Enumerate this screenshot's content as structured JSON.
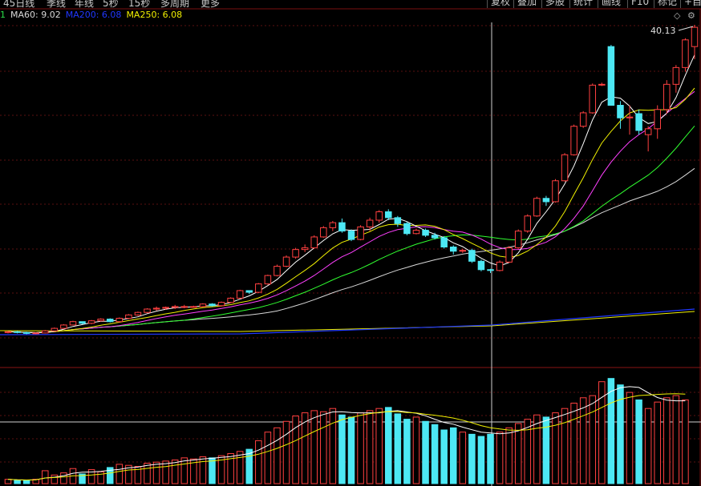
{
  "toolbar": {
    "periods": [
      "45日线",
      "季线",
      "年线",
      "5秒",
      "15秒",
      "多周期",
      "更多"
    ],
    "buttons": [
      "复权",
      "叠加",
      "多股",
      "统计",
      "画线",
      "F10",
      "标记",
      "+自选"
    ]
  },
  "ma_legend": [
    {
      "label": "1",
      "color": "#2adf4a"
    },
    {
      "label": "MA60: 9.02",
      "color": "#d8d8d8"
    },
    {
      "label": "MA200: 6.08",
      "color": "#2038ff"
    },
    {
      "label": "MA250: 6.08",
      "color": "#f0f000"
    }
  ],
  "colors": {
    "up": "#ff4040",
    "down": "#4de8f4",
    "ma5": "#ffffff",
    "ma10": "#f0f000",
    "ma20": "#ff40ff",
    "ma30": "#30ff30",
    "ma60": "#d8d8d8",
    "ma200": "#2038ff",
    "ma250": "#f0f000"
  },
  "chart_data": {
    "type": "candlestick",
    "price_label": "40.13",
    "price_range": [
      2.5,
      40.5
    ],
    "candles": [
      {
        "o": 3.9,
        "h": 4.1,
        "l": 3.8,
        "c": 4.0
      },
      {
        "o": 4.0,
        "h": 4.1,
        "l": 3.8,
        "c": 3.9
      },
      {
        "o": 3.9,
        "h": 4.0,
        "l": 3.7,
        "c": 3.8
      },
      {
        "o": 3.8,
        "h": 3.9,
        "l": 3.7,
        "c": 3.85
      },
      {
        "o": 3.85,
        "h": 4.2,
        "l": 3.8,
        "c": 4.1
      },
      {
        "o": 4.1,
        "h": 4.5,
        "l": 4.0,
        "c": 4.4
      },
      {
        "o": 4.4,
        "h": 4.9,
        "l": 4.3,
        "c": 4.8
      },
      {
        "o": 4.8,
        "h": 5.3,
        "l": 4.8,
        "c": 5.2
      },
      {
        "o": 5.2,
        "h": 5.2,
        "l": 4.9,
        "c": 5.0
      },
      {
        "o": 5.0,
        "h": 5.4,
        "l": 4.9,
        "c": 5.3
      },
      {
        "o": 5.3,
        "h": 5.6,
        "l": 5.2,
        "c": 5.5
      },
      {
        "o": 5.5,
        "h": 5.6,
        "l": 5.1,
        "c": 5.2
      },
      {
        "o": 5.2,
        "h": 5.7,
        "l": 5.1,
        "c": 5.6
      },
      {
        "o": 5.6,
        "h": 6.1,
        "l": 5.5,
        "c": 6.0
      },
      {
        "o": 6.0,
        "h": 6.4,
        "l": 5.9,
        "c": 6.3
      },
      {
        "o": 6.3,
        "h": 6.8,
        "l": 6.2,
        "c": 6.7
      },
      {
        "o": 6.7,
        "h": 7.0,
        "l": 6.5,
        "c": 6.8
      },
      {
        "o": 6.8,
        "h": 7.0,
        "l": 6.6,
        "c": 6.9
      },
      {
        "o": 6.9,
        "h": 7.2,
        "l": 6.7,
        "c": 7.0
      },
      {
        "o": 7.0,
        "h": 7.2,
        "l": 6.8,
        "c": 7.0
      },
      {
        "o": 7.0,
        "h": 7.1,
        "l": 6.9,
        "c": 7.0
      },
      {
        "o": 7.0,
        "h": 7.4,
        "l": 6.9,
        "c": 7.3
      },
      {
        "o": 7.3,
        "h": 7.4,
        "l": 7.0,
        "c": 7.1
      },
      {
        "o": 7.1,
        "h": 7.6,
        "l": 7.0,
        "c": 7.5
      },
      {
        "o": 7.5,
        "h": 8.1,
        "l": 7.4,
        "c": 8.0
      },
      {
        "o": 8.0,
        "h": 9.0,
        "l": 7.9,
        "c": 8.9
      },
      {
        "o": 8.9,
        "h": 8.9,
        "l": 8.5,
        "c": 8.7
      },
      {
        "o": 8.7,
        "h": 9.8,
        "l": 8.6,
        "c": 9.7
      },
      {
        "o": 9.7,
        "h": 10.8,
        "l": 9.6,
        "c": 10.7
      },
      {
        "o": 10.7,
        "h": 12.0,
        "l": 10.6,
        "c": 11.8
      },
      {
        "o": 11.8,
        "h": 13.1,
        "l": 11.7,
        "c": 12.9
      },
      {
        "o": 12.9,
        "h": 14.0,
        "l": 12.7,
        "c": 13.8
      },
      {
        "o": 13.8,
        "h": 14.4,
        "l": 13.5,
        "c": 14.0
      },
      {
        "o": 14.0,
        "h": 15.5,
        "l": 13.9,
        "c": 15.3
      },
      {
        "o": 15.3,
        "h": 16.6,
        "l": 15.2,
        "c": 16.4
      },
      {
        "o": 16.4,
        "h": 17.2,
        "l": 16.0,
        "c": 17.0
      },
      {
        "o": 17.0,
        "h": 17.5,
        "l": 15.8,
        "c": 16.0
      },
      {
        "o": 16.0,
        "h": 16.2,
        "l": 14.8,
        "c": 15.0
      },
      {
        "o": 15.0,
        "h": 16.7,
        "l": 14.9,
        "c": 16.5
      },
      {
        "o": 16.5,
        "h": 17.6,
        "l": 16.0,
        "c": 17.3
      },
      {
        "o": 17.3,
        "h": 18.5,
        "l": 17.0,
        "c": 18.3
      },
      {
        "o": 18.3,
        "h": 18.6,
        "l": 17.3,
        "c": 17.6
      },
      {
        "o": 17.6,
        "h": 17.8,
        "l": 16.5,
        "c": 16.9
      },
      {
        "o": 16.9,
        "h": 17.1,
        "l": 15.5,
        "c": 15.7
      },
      {
        "o": 15.7,
        "h": 16.3,
        "l": 15.6,
        "c": 16.1
      },
      {
        "o": 16.1,
        "h": 16.3,
        "l": 15.3,
        "c": 15.5
      },
      {
        "o": 15.5,
        "h": 15.8,
        "l": 15.0,
        "c": 15.2
      },
      {
        "o": 15.2,
        "h": 15.4,
        "l": 13.9,
        "c": 14.1
      },
      {
        "o": 14.1,
        "h": 14.3,
        "l": 13.2,
        "c": 13.6
      },
      {
        "o": 13.6,
        "h": 13.9,
        "l": 13.4,
        "c": 13.7
      },
      {
        "o": 13.7,
        "h": 13.9,
        "l": 12.2,
        "c": 12.4
      },
      {
        "o": 12.4,
        "h": 12.6,
        "l": 11.2,
        "c": 11.4
      },
      {
        "o": 11.4,
        "h": 11.5,
        "l": 11.0,
        "c": 11.3
      },
      {
        "o": 11.3,
        "h": 12.5,
        "l": 11.2,
        "c": 12.3
      },
      {
        "o": 12.3,
        "h": 14.2,
        "l": 12.2,
        "c": 14.0
      },
      {
        "o": 14.0,
        "h": 16.2,
        "l": 13.9,
        "c": 16.0
      },
      {
        "o": 16.0,
        "h": 18.0,
        "l": 15.8,
        "c": 17.8
      },
      {
        "o": 17.8,
        "h": 20.1,
        "l": 17.7,
        "c": 19.9
      },
      {
        "o": 19.9,
        "h": 20.2,
        "l": 19.0,
        "c": 19.5
      },
      {
        "o": 19.5,
        "h": 22.2,
        "l": 19.4,
        "c": 22.0
      },
      {
        "o": 22.0,
        "h": 25.3,
        "l": 21.9,
        "c": 25.1
      },
      {
        "o": 25.1,
        "h": 28.7,
        "l": 25.0,
        "c": 28.5
      },
      {
        "o": 28.5,
        "h": 30.3,
        "l": 28.3,
        "c": 30.1
      },
      {
        "o": 30.1,
        "h": 33.6,
        "l": 30.0,
        "c": 33.4
      },
      {
        "o": 33.5,
        "h": 33.7,
        "l": 33.3,
        "c": 33.5
      },
      {
        "o": 38.0,
        "h": 38.2,
        "l": 31.0,
        "c": 31.0
      },
      {
        "o": 31.0,
        "h": 31.5,
        "l": 28.2,
        "c": 29.5
      },
      {
        "o": 29.5,
        "h": 31.0,
        "l": 27.5,
        "c": 29.6
      },
      {
        "o": 30.0,
        "h": 30.5,
        "l": 27.5,
        "c": 28.0
      },
      {
        "o": 27.5,
        "h": 28.5,
        "l": 25.5,
        "c": 28.2
      },
      {
        "o": 28.2,
        "h": 31.0,
        "l": 27.0,
        "c": 30.5
      },
      {
        "o": 30.5,
        "h": 34.0,
        "l": 30.0,
        "c": 33.5
      },
      {
        "o": 33.5,
        "h": 35.8,
        "l": 32.5,
        "c": 35.5
      },
      {
        "o": 35.5,
        "h": 39.0,
        "l": 35.0,
        "c": 38.8
      },
      {
        "o": 38.0,
        "h": 40.6,
        "l": 36.5,
        "c": 40.3
      }
    ],
    "volume": {
      "range": [
        0,
        100
      ],
      "bars": [
        4,
        3,
        3,
        4,
        12,
        8,
        10,
        14,
        9,
        13,
        11,
        15,
        18,
        17,
        16,
        19,
        20,
        21,
        22,
        24,
        23,
        25,
        24,
        26,
        28,
        30,
        32,
        40,
        48,
        52,
        58,
        63,
        66,
        68,
        67,
        70,
        64,
        62,
        66,
        68,
        70,
        71,
        65,
        60,
        62,
        58,
        55,
        50,
        52,
        48,
        46,
        44,
        46,
        48,
        52,
        56,
        60,
        64,
        62,
        66,
        70,
        75,
        80,
        82,
        95,
        98,
        92,
        85,
        78,
        70,
        76,
        80,
        82,
        78
      ]
    }
  }
}
